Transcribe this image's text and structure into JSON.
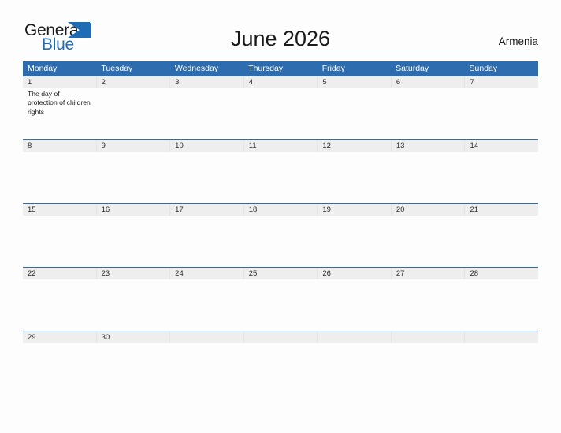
{
  "brand": {
    "name_part1": "General",
    "name_part2": "Blue",
    "triangle_icon": "blue-triangle-icon",
    "accent_color": "#1f6cb4"
  },
  "header": {
    "title": "June 2026",
    "country": "Armenia"
  },
  "theme": {
    "header_blue": "#2e6cb0",
    "date_band_gray": "#eeeeee",
    "page_background": "#fdfdfd",
    "text_dark": "#1c1c1c",
    "header_text": "#ffffff"
  },
  "calendar": {
    "month": "June",
    "year": "2026",
    "week_start": "Monday",
    "day_headers": [
      "Monday",
      "Tuesday",
      "Wednesday",
      "Thursday",
      "Friday",
      "Saturday",
      "Sunday"
    ],
    "weeks": [
      {
        "days": [
          {
            "date": "1",
            "events": [
              "The day of protection of children rights"
            ]
          },
          {
            "date": "2",
            "events": []
          },
          {
            "date": "3",
            "events": []
          },
          {
            "date": "4",
            "events": []
          },
          {
            "date": "5",
            "events": []
          },
          {
            "date": "6",
            "events": []
          },
          {
            "date": "7",
            "events": []
          }
        ]
      },
      {
        "days": [
          {
            "date": "8",
            "events": []
          },
          {
            "date": "9",
            "events": []
          },
          {
            "date": "10",
            "events": []
          },
          {
            "date": "11",
            "events": []
          },
          {
            "date": "12",
            "events": []
          },
          {
            "date": "13",
            "events": []
          },
          {
            "date": "14",
            "events": []
          }
        ]
      },
      {
        "days": [
          {
            "date": "15",
            "events": []
          },
          {
            "date": "16",
            "events": []
          },
          {
            "date": "17",
            "events": []
          },
          {
            "date": "18",
            "events": []
          },
          {
            "date": "19",
            "events": []
          },
          {
            "date": "20",
            "events": []
          },
          {
            "date": "21",
            "events": []
          }
        ]
      },
      {
        "days": [
          {
            "date": "22",
            "events": []
          },
          {
            "date": "23",
            "events": []
          },
          {
            "date": "24",
            "events": []
          },
          {
            "date": "25",
            "events": []
          },
          {
            "date": "26",
            "events": []
          },
          {
            "date": "27",
            "events": []
          },
          {
            "date": "28",
            "events": []
          }
        ]
      },
      {
        "days": [
          {
            "date": "29",
            "events": []
          },
          {
            "date": "30",
            "events": []
          },
          {
            "date": "",
            "events": []
          },
          {
            "date": "",
            "events": []
          },
          {
            "date": "",
            "events": []
          },
          {
            "date": "",
            "events": []
          },
          {
            "date": "",
            "events": []
          }
        ]
      }
    ]
  }
}
